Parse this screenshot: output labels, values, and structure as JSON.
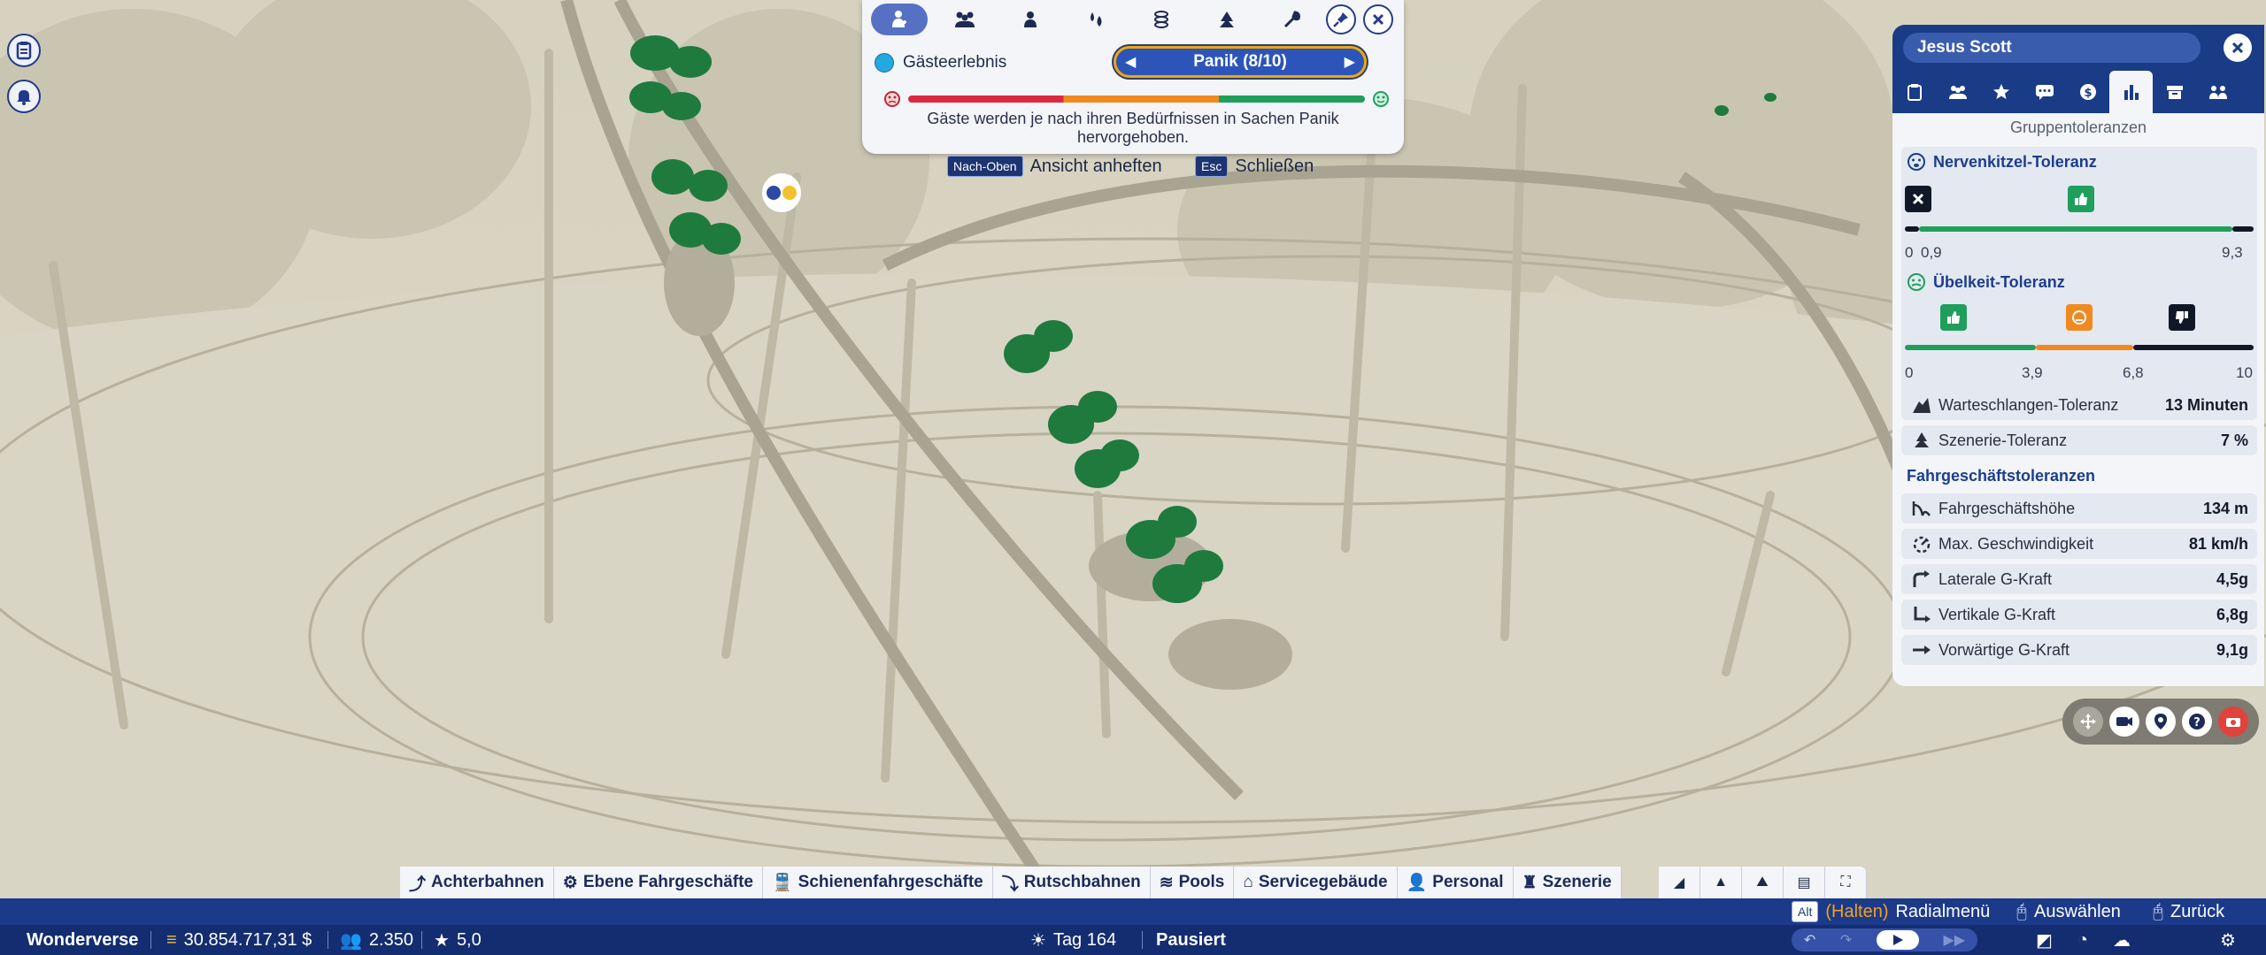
{
  "guest_info": {
    "tabs": [
      {
        "icon": "guest-add-icon",
        "active": true
      },
      {
        "icon": "group-icon"
      },
      {
        "icon": "person-icon"
      },
      {
        "icon": "needs-icon"
      },
      {
        "icon": "coins-icon"
      },
      {
        "icon": "scenery-icon"
      },
      {
        "icon": "wrench-icon"
      }
    ],
    "experience_label": "Gästeerlebnis",
    "selector_value": "Panik (8/10)",
    "description": "Gäste werden je nach ihren Bedürfnissen in Sachen Panik hervorgehoben.",
    "colors": {
      "bad": "#d92a3f",
      "mid": "#f08a20",
      "good": "#1f9f5b",
      "accent": "#2d55b9",
      "highlight": "#e9a913"
    }
  },
  "key_hints": {
    "pin": {
      "key": "Nach-Oben",
      "label": "Ansicht anheften"
    },
    "close": {
      "key": "Esc",
      "label": "Schließen"
    }
  },
  "guest_panel": {
    "name": "Jesus Scott",
    "tabs": [
      "clipboard-icon",
      "group-icon",
      "star-icon",
      "chat-icon",
      "money-icon",
      "chart-icon",
      "box-icon",
      "people-icon"
    ],
    "active_tab": 5,
    "section_title": "Gruppentoleranzen",
    "thrill": {
      "title": "Nervenkitzel-Toleranz",
      "labels": [
        "0",
        "0,9",
        "9,3"
      ]
    },
    "nausea": {
      "title": "Übelkeit-Toleranz",
      "labels": [
        "0",
        "3,9",
        "6,8",
        "10"
      ]
    },
    "queue": {
      "label": "Warteschlangen-Toleranz",
      "value": "13 Minuten"
    },
    "scenery": {
      "label": "Szenerie-Toleranz",
      "value": "7 %"
    },
    "ride_title": "Fahrgeschäftstoleranzen",
    "ride_rows": [
      {
        "label": "Fahrgeschäftshöhe",
        "value": "134 m",
        "icon": "height-icon"
      },
      {
        "label": "Max. Geschwindigkeit",
        "value": "81 km/h",
        "icon": "speed-icon"
      },
      {
        "label": "Laterale G-Kraft",
        "value": "4,5g",
        "icon": "lateral-arrow-icon"
      },
      {
        "label": "Vertikale G-Kraft",
        "value": "6,8g",
        "icon": "vertical-arrow-icon"
      },
      {
        "label": "Vorwärtige G-Kraft",
        "value": "9,1g",
        "icon": "forward-arrow-icon"
      }
    ]
  },
  "categories": [
    {
      "label": "Achterbahnen",
      "icon": "coaster-icon"
    },
    {
      "label": "Ebene Fahrgeschäfte",
      "icon": "flat-ride-icon"
    },
    {
      "label": "Schienenfahrgeschäfte",
      "icon": "train-icon"
    },
    {
      "label": "Rutschbahnen",
      "icon": "slide-icon"
    },
    {
      "label": "Pools",
      "icon": "pool-icon"
    },
    {
      "label": "Servicegebäude",
      "icon": "shop-icon"
    },
    {
      "label": "Personal",
      "icon": "staff-icon"
    },
    {
      "label": "Szenerie",
      "icon": "scenery-icon"
    }
  ],
  "hint_bar": {
    "alt_key": "Alt",
    "hold": "(Halten)",
    "radial": "Radialmenü",
    "select": "Auswählen",
    "back": "Zurück"
  },
  "status_bar": {
    "park_name": "Wonderverse",
    "money": "30.854.717,31 $",
    "guests": "2.350",
    "rating": "5,0",
    "day": "Tag 164",
    "state": "Pausiert"
  }
}
